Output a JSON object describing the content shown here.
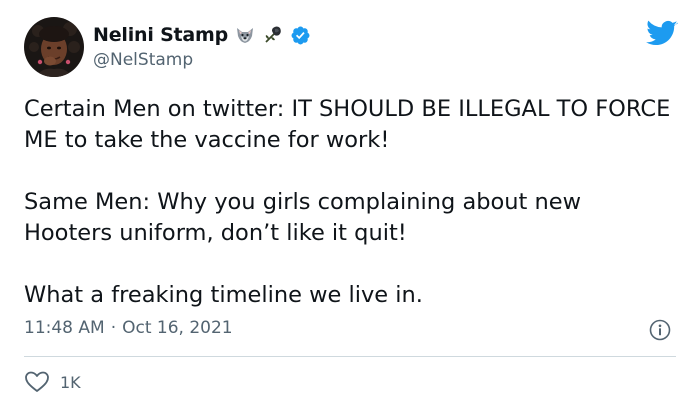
{
  "author": {
    "display_name": "Nelini Stamp",
    "handle": "@NelStamp",
    "verified": true,
    "name_emojis": [
      "wolf-face-emoji",
      "rose-emoji"
    ],
    "avatar": "profile-photo"
  },
  "brand_icon": "twitter-bird-icon",
  "colors": {
    "brand": "#1d9bf0",
    "text": "#0f1419",
    "secondary": "#536471",
    "divider": "#cfd9de"
  },
  "tweet": {
    "paragraphs": [
      "Certain Men on twitter: IT SHOULD BE ILLEGAL TO FORCE ME to take the vaccine for work!",
      "Same Men: Why you girls complaining about new Hooters uniform, don’t like it quit!",
      "What a freaking timeline we live in."
    ],
    "time": "11:48 AM",
    "separator": "·",
    "date": "Oct 16, 2021"
  },
  "actions": {
    "like_count": "1K"
  }
}
